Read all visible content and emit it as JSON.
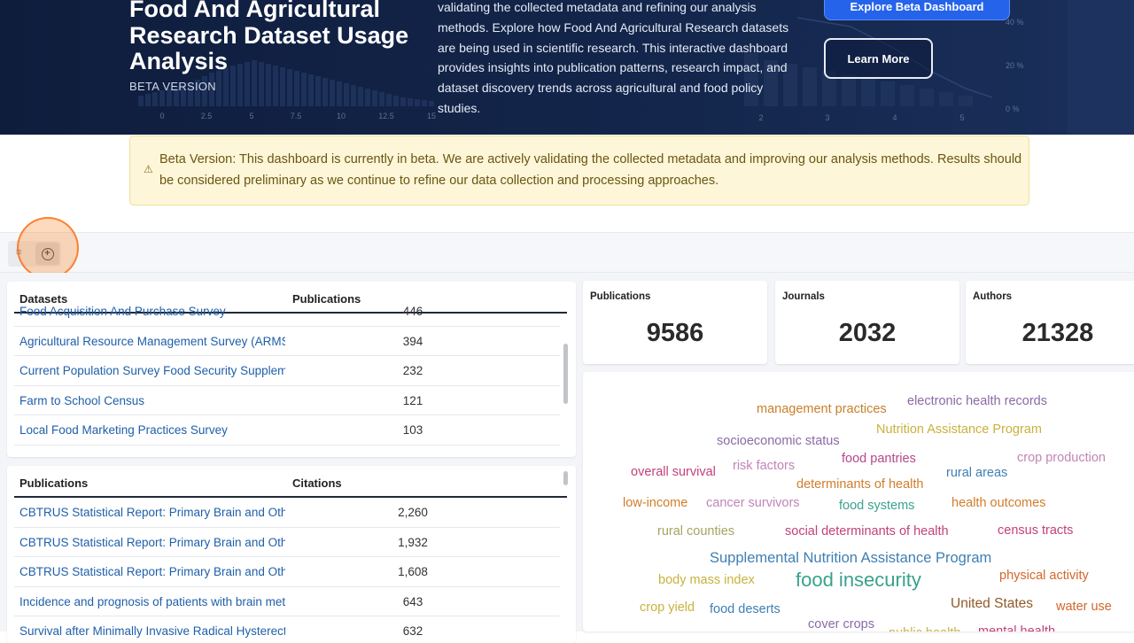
{
  "hero": {
    "title": "Food And Agricultural Research Dataset Usage Analysis",
    "subtitle": "BETA VERSION",
    "description": "validating the collected metadata and refining our analysis methods. Explore how Food And Agricultural Research datasets are being used in scientific research. This interactive dashboard provides insights into publication patterns, research impact, and dataset discovery trends across agricultural and food policy studies.",
    "primary_button": "Explore Beta Dashboard",
    "secondary_button": "Learn More",
    "bg_axis_left": [
      "0",
      "2.5",
      "5",
      "7.5",
      "10",
      "12.5",
      "15"
    ],
    "bg_axis_right": [
      "2",
      "3",
      "4",
      "5"
    ],
    "bg_pct": [
      "40 %",
      "20 %",
      "0 %"
    ]
  },
  "beta_notice": {
    "icon": "warning-icon",
    "text": "Beta Version: This dashboard is currently in beta. We are actively validating the collected metadata and improving our analysis methods. Results should be considered preliminary as we continue to refine our data collection and processing approaches."
  },
  "toolbar": {
    "filter_icon": "filter-icon",
    "add_icon": "plus-circle-icon"
  },
  "datasets_table": {
    "headers": [
      "Datasets",
      "Publications"
    ],
    "rows": [
      {
        "name": "Food Acquisition And Purchase Survey",
        "count": "446"
      },
      {
        "name": "Agricultural Resource Management Survey (ARMS)",
        "count": "394"
      },
      {
        "name": "Current Population Survey Food Security Supplement",
        "count": "232"
      },
      {
        "name": "Farm to School Census",
        "count": "121"
      },
      {
        "name": "Local Food Marketing Practices Survey",
        "count": "103"
      }
    ]
  },
  "publications_table": {
    "headers": [
      "Publications",
      "Citations"
    ],
    "rows": [
      {
        "name": "CBTRUS Statistical Report: Primary Brain and Other Central Nervous System Tumors",
        "count": "2,260"
      },
      {
        "name": "CBTRUS Statistical Report: Primary Brain and Other Central Nervous System Tumors",
        "count": "1,932"
      },
      {
        "name": "CBTRUS Statistical Report: Primary Brain and Other Central Nervous System Tumors",
        "count": "1,608"
      },
      {
        "name": "Incidence and prognosis of patients with brain metastases",
        "count": "643"
      },
      {
        "name": "Survival after Minimally Invasive Radical Hysterectomy",
        "count": "632"
      }
    ]
  },
  "kpis": [
    {
      "label": "Publications",
      "value": "9586"
    },
    {
      "label": "Journals",
      "value": "2032"
    },
    {
      "label": "Authors",
      "value": "21328"
    }
  ],
  "word_cloud": [
    {
      "text": "management practices",
      "color": "#c87f2a"
    },
    {
      "text": "electronic health records",
      "color": "#8a6aa6"
    },
    {
      "text": "Nutrition Assistance Program",
      "color": "#c9b23d"
    },
    {
      "text": "socioeconomic status",
      "color": "#8a6aa6"
    },
    {
      "text": "crop production",
      "color": "#c285b8"
    },
    {
      "text": "food pantries",
      "color": "#b5478a"
    },
    {
      "text": "overall survival",
      "color": "#c2417a"
    },
    {
      "text": "risk factors",
      "color": "#c285b8"
    },
    {
      "text": "rural areas",
      "color": "#3f7fb3"
    },
    {
      "text": "determinants of health",
      "color": "#d17d2a"
    },
    {
      "text": "low-income",
      "color": "#d17d2a"
    },
    {
      "text": "cancer survivors",
      "color": "#c285b8"
    },
    {
      "text": "food systems",
      "color": "#3aa18e"
    },
    {
      "text": "health outcomes",
      "color": "#d17d2a"
    },
    {
      "text": "rural counties",
      "color": "#a6a460"
    },
    {
      "text": "social determinants of health",
      "color": "#c2417a"
    },
    {
      "text": "census tracts",
      "color": "#c2417a"
    },
    {
      "text": "Supplemental Nutrition Assistance Program",
      "color": "#3f7fb3"
    },
    {
      "text": "body mass index",
      "color": "#c9b23d"
    },
    {
      "text": "food insecurity",
      "color": "#3aa18e"
    },
    {
      "text": "physical activity",
      "color": "#d4662a"
    },
    {
      "text": "crop yield",
      "color": "#c9b23d"
    },
    {
      "text": "food deserts",
      "color": "#3f7fb3"
    },
    {
      "text": "United States",
      "color": "#8f5a2a"
    },
    {
      "text": "water use",
      "color": "#d4662a"
    },
    {
      "text": "cover crops",
      "color": "#8a6aa6"
    },
    {
      "text": "mental health",
      "color": "#c2417a"
    },
    {
      "text": "public health",
      "color": "#c9b23d"
    }
  ],
  "colors": {
    "hero_bg": "#13254a",
    "primary": "#2563eb",
    "link": "#1f5fa9",
    "beta_bg": "#fdf6d8"
  }
}
